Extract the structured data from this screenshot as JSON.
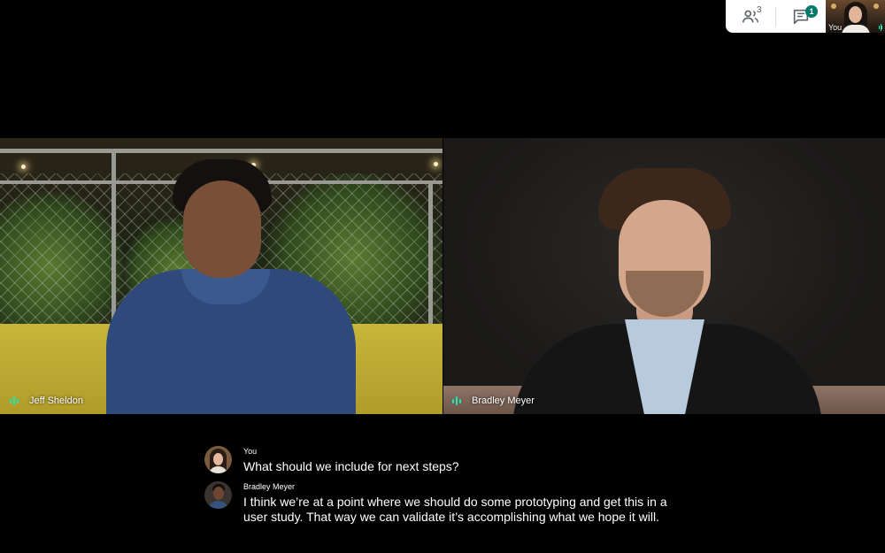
{
  "controls": {
    "people_icon": "people-icon",
    "people_count": "3",
    "chat_icon": "chat-icon",
    "chat_badge": "1"
  },
  "self_view": {
    "label": "You"
  },
  "tiles": [
    {
      "name": "Jeff Sheldon"
    },
    {
      "name": "Bradley Meyer"
    }
  ],
  "captions": [
    {
      "speaker": "You",
      "lines": [
        "What should we include for next steps?"
      ]
    },
    {
      "speaker": "Bradley Meyer",
      "lines": [
        "I think we’re at a point where we should do some prototyping and get this in a",
        "user study. That way we can validate it’s accomplishing what we hope it will."
      ]
    }
  ],
  "colors": {
    "accent": "#00796b",
    "mic_indicator": "#1de9b6",
    "background": "#000000"
  }
}
